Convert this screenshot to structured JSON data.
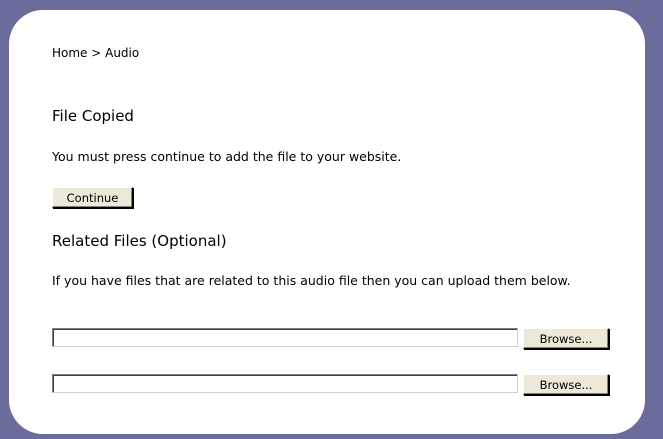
{
  "breadcrumb": "Home > Audio",
  "file_copied": {
    "heading": "File Copied",
    "message": "You must press continue to add the file to your website.",
    "continue_label": "Continue"
  },
  "related_files": {
    "heading": "Related Files (Optional)",
    "message": "If you have files that are related to this audio file then you can upload them below.",
    "inputs": [
      {
        "value": "",
        "browse_label": "Browse..."
      },
      {
        "value": "",
        "browse_label": "Browse..."
      }
    ]
  }
}
